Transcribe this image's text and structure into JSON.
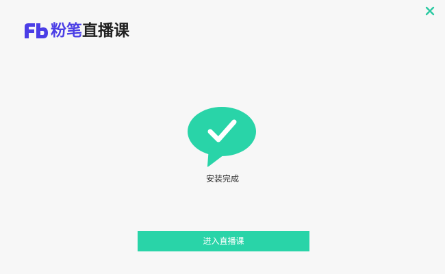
{
  "colors": {
    "background": "#f7f7f7",
    "brand": "#4b3ee6",
    "accent": "#29d4a8",
    "close_icon": "#27c9a0",
    "text": "#333333"
  },
  "header": {
    "logo_mark": "Fb",
    "logo_brand": "粉笔",
    "logo_product": "直播课"
  },
  "window_controls": {
    "close_icon": "close-icon"
  },
  "main": {
    "status_icon": "chat-bubble-check-icon",
    "status_text": "安装完成",
    "enter_button_label": "进入直播课"
  }
}
